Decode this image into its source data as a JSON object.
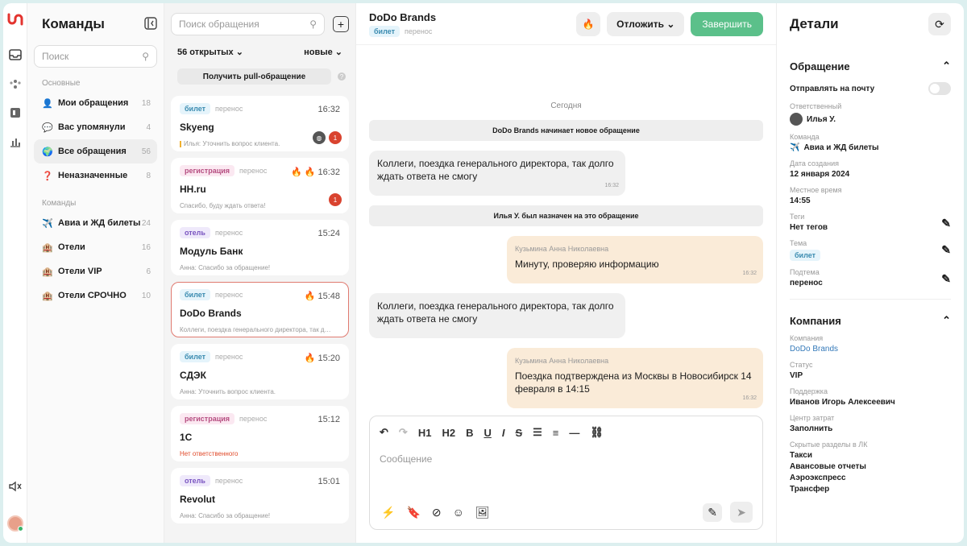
{
  "rail": {
    "icons": [
      "logo-icon",
      "inbox-icon",
      "team-icon",
      "calendar-icon",
      "chart-icon",
      "mute-icon",
      "user-avatar"
    ]
  },
  "teams": {
    "title": "Команды",
    "search_placeholder": "Поиск",
    "section_main": "Основные",
    "main_items": [
      {
        "label": "Мои обращения",
        "count": "18",
        "emoji": "👤"
      },
      {
        "label": "Вас упомянули",
        "count": "4",
        "emoji": "💬"
      },
      {
        "label": "Все обращения",
        "count": "56",
        "emoji": "🌍"
      },
      {
        "label": "Неназначенные",
        "count": "8",
        "emoji": "❓"
      }
    ],
    "section_teams": "Команды",
    "team_items": [
      {
        "label": "Авиа и ЖД билеты",
        "count": "24",
        "emoji": "✈️"
      },
      {
        "label": "Отели",
        "count": "16",
        "emoji": "🏨"
      },
      {
        "label": "Отели VIP",
        "count": "6",
        "emoji": "🏨"
      },
      {
        "label": "Отели СРОЧНО",
        "count": "10",
        "emoji": "🏨"
      }
    ]
  },
  "list": {
    "search_placeholder": "Поиск обращения",
    "open_count": "56 открытых",
    "sort": "новые",
    "pull_button": "Получить pull-обращение",
    "cards": [
      {
        "tag": "билет",
        "sub": "перенос",
        "time": "16:32",
        "title": "Skyeng",
        "preview": "Илья: Уточнить вопрос клиента.",
        "badge": "1"
      },
      {
        "tag": "регистрация",
        "sub": "перенос",
        "time": "16:32",
        "title": "HH.ru",
        "preview": "Спасибо, буду ждать ответа!",
        "badge": "1"
      },
      {
        "tag": "отель",
        "sub": "перенос",
        "time": "15:24",
        "title": "Модуль Банк",
        "preview": "Анна: Спасибо за обращение!"
      },
      {
        "tag": "билет",
        "sub": "перенос",
        "time": "15:48",
        "title": "DoDo Brands",
        "preview": "Коллеги, поездка генерального директора, так до..."
      },
      {
        "tag": "билет",
        "sub": "перенос",
        "time": "15:20",
        "title": "СДЭК",
        "preview": "Анна: Уточнить вопрос клиента."
      },
      {
        "tag": "регистрация",
        "sub": "перенос",
        "time": "15:12",
        "title": "1С",
        "preview": "Нет ответственного"
      },
      {
        "tag": "отель",
        "sub": "перенос",
        "time": "15:01",
        "title": "Revolut",
        "preview": "Анна: Спасибо за обращение!"
      }
    ]
  },
  "chat": {
    "title": "DoDo Brands",
    "tag": "билет",
    "sub": "перенос",
    "postpone": "Отложить",
    "finish": "Завершить",
    "day": "Сегодня",
    "sys1": "DoDo Brands начинает новое обращение",
    "msg1": "Коллеги, поездка генерального директора, так долго ждать ответа не смогу",
    "msg1_time": "16:32",
    "sys2": "Илья У. был назначен на это обращение",
    "agent": "Кузьмина Анна Николаевна",
    "msg2": "Минуту, проверяю информацию",
    "msg2_time": "16:32",
    "msg3": "Коллеги, поездка генерального директора, так долго ждать ответа не смогу",
    "msg4": "Поездка подтверждена из Москвы в Новосибирск 14 февраля в 14:15",
    "msg4_time": "16:32",
    "composer_placeholder": "Сообщение",
    "toolbar": {
      "h1": "H1",
      "h2": "H2",
      "bold": "B",
      "underline": "U",
      "italic": "I",
      "strike": "S"
    }
  },
  "details": {
    "title": "Детали",
    "case_section": "Обращение",
    "send_email": "Отправлять на почту",
    "owner_label": "Ответственный",
    "owner": "Илья У.",
    "team_label": "Команда",
    "team": "Авиа и ЖД билеты",
    "created_label": "Дата создания",
    "created": "12 января 2024",
    "local_label": "Местное время",
    "local": "14:55",
    "tags_label": "Теги",
    "tags": "Нет тегов",
    "topic_label": "Тема",
    "topic": "билет",
    "subtopic_label": "Подтема",
    "subtopic": "перенос",
    "company_section": "Компания",
    "company_label": "Компания",
    "company": "DoDo Brands",
    "status_label": "Статус",
    "status": "VIP",
    "support_label": "Поддержка",
    "support": "Иванов Игорь Алексеевич",
    "cost_label": "Центр затрат",
    "cost": "Заполнить",
    "hidden_label": "Скрытые разделы в ЛК",
    "hidden": [
      "Такси",
      "Авансовые отчеты",
      "Аэроэкспресс",
      "Трансфер"
    ]
  }
}
